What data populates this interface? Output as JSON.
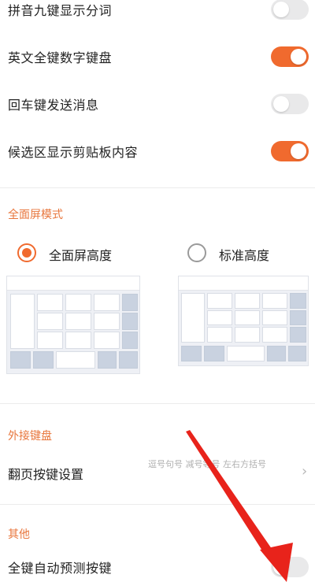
{
  "settings_top": [
    {
      "label": "拼音九键显示分词",
      "enabled": false
    },
    {
      "label": "英文全键数字键盘",
      "enabled": true
    },
    {
      "label": "回车键发送消息",
      "enabled": false
    },
    {
      "label": "候选区显示剪贴板内容",
      "enabled": true
    }
  ],
  "fullscreen_mode": {
    "title": "全面屏模式",
    "options": [
      {
        "label": "全面屏高度",
        "selected": true
      },
      {
        "label": "标准高度",
        "selected": false
      }
    ]
  },
  "external_keyboard": {
    "title": "外接键盘",
    "page_key_setting": {
      "label": "翻页按键设置",
      "value": "逗号句号 减号等号 左右方括号"
    }
  },
  "other": {
    "title": "其他",
    "items": [
      {
        "label": "全键自动预测按键",
        "enabled": false
      }
    ]
  },
  "colors": {
    "accent": "#f06a2e",
    "section_title": "#e8763c",
    "arrow": "#e8231b"
  },
  "icons": {
    "chevron": "chevron-right-icon"
  }
}
